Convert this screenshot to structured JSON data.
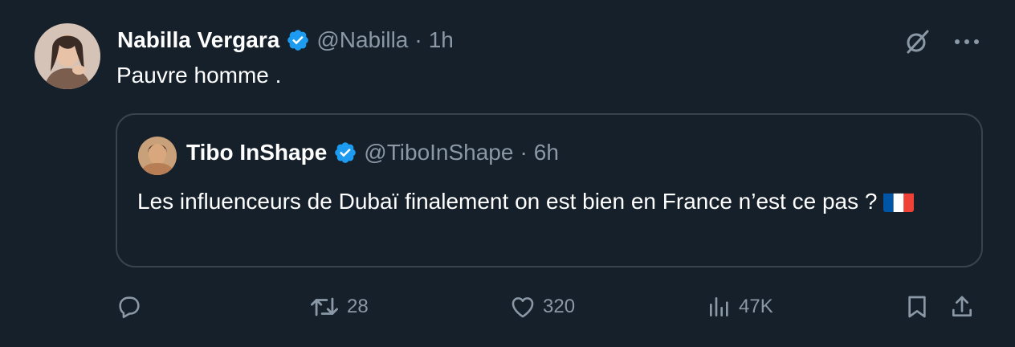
{
  "tweet": {
    "author_name": "Nabilla Vergara",
    "author_handle": "@Nabilla",
    "separator": "·",
    "time": "1h",
    "text": "Pauvre homme ."
  },
  "quoted_tweet": {
    "author_name": "Tibo InShape",
    "author_handle": "@TiboInShape",
    "separator": "·",
    "time": "6h",
    "text": "Les influenceurs de Dubaï finalement on est bien en France n’est ce pas ?",
    "emoji": "french-flag"
  },
  "actions": {
    "reply_count": "",
    "retweet_count": "28",
    "like_count": "320",
    "view_count": "47K"
  },
  "icons": {
    "verified": "verified-badge-icon",
    "grok": "grok-icon",
    "more": "more-icon",
    "reply": "reply-icon",
    "retweet": "retweet-icon",
    "like": "heart-icon",
    "views": "views-icon",
    "bookmark": "bookmark-icon",
    "share": "share-icon"
  },
  "colors": {
    "background": "#15202b",
    "primary_text": "#ffffff",
    "secondary_text": "#8b98a5",
    "border": "#38444d",
    "verified": "#1d9bf0",
    "flag_blue": "#0055a4",
    "flag_white": "#ffffff",
    "flag_red": "#ef4135"
  }
}
